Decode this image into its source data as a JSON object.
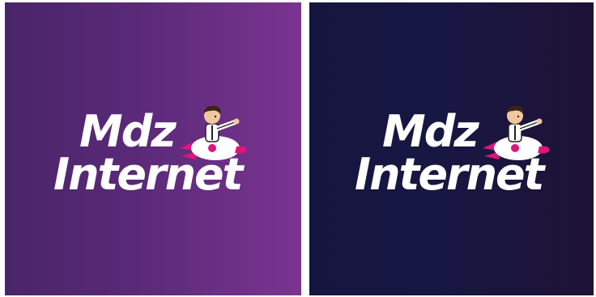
{
  "tiles": [
    {
      "variant": "purple",
      "logo": {
        "line1": "Mdz",
        "line2": "Internet",
        "mascot_icon": "rocket-rider-mascot-icon"
      },
      "background_colors": [
        "#4a246a",
        "#7a3490"
      ]
    },
    {
      "variant": "dark-navy",
      "logo": {
        "line1": "Mdz",
        "line2": "Internet",
        "mascot_icon": "rocket-rider-mascot-icon"
      },
      "background_colors": [
        "#15153f",
        "#1f1235"
      ]
    }
  ],
  "colors": {
    "text": "#ffffff",
    "rocket": "#e0147a",
    "skin": "#f2c7a0",
    "hair": "#3a2418"
  }
}
